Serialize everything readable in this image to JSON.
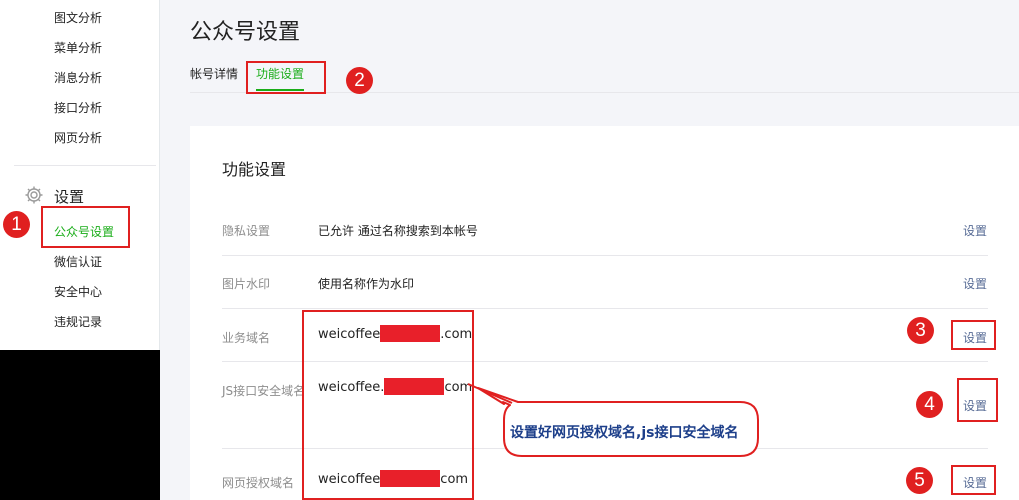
{
  "sidebar": {
    "items_top": [
      "图文分析",
      "菜单分析",
      "消息分析",
      "接口分析",
      "网页分析"
    ],
    "section_title": "设置",
    "section_icon": "gear-icon",
    "items_settings": [
      "公众号设置",
      "微信认证",
      "安全中心",
      "违规记录"
    ],
    "active_item": "公众号设置"
  },
  "header": {
    "title": "公众号设置",
    "tabs": [
      {
        "label": "帐号详情",
        "active": false
      },
      {
        "label": "功能设置",
        "active": true
      }
    ]
  },
  "card": {
    "title": "功能设置",
    "rows": [
      {
        "label": "隐私设置",
        "value": "已允许 通过名称搜索到本帐号",
        "action": "设置"
      },
      {
        "label": "图片水印",
        "value": "使用名称作为水印",
        "action": "设置"
      },
      {
        "label": "业务域名",
        "value_prefix": "weicoffee",
        "value_suffix": ".com",
        "action": "设置"
      },
      {
        "label": "JS接口安全域名",
        "value_prefix": "weicoffee.",
        "value_suffix": "com",
        "action": "设置"
      },
      {
        "label": "网页授权域名",
        "value_prefix": "weicoffee",
        "value_suffix": "com",
        "action": "设置"
      }
    ]
  },
  "annotations": {
    "numbers": [
      "1",
      "2",
      "3",
      "4",
      "5"
    ],
    "callout": "设置好网页授权域名,js接口安全域名",
    "color": "#e02020"
  },
  "colors": {
    "accent_green": "#1aad19",
    "link_blue": "#576b95",
    "redaction": "#e8202a"
  }
}
